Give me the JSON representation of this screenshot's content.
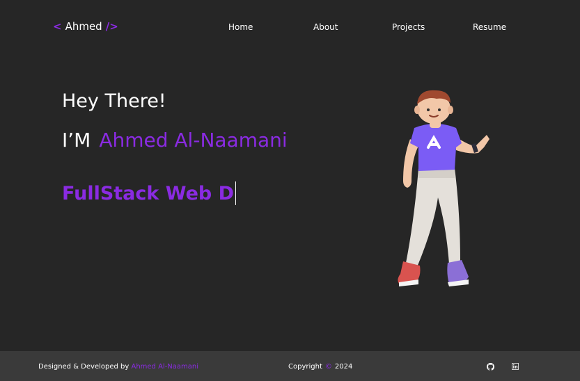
{
  "header": {
    "logo_open": "<",
    "logo_name": "Ahmed",
    "logo_close": "/>",
    "nav": [
      {
        "label": "Home"
      },
      {
        "label": "About"
      },
      {
        "label": "Projects"
      },
      {
        "label": "Resume"
      }
    ]
  },
  "hero": {
    "greeting": "Hey There!",
    "intro_prefix": "I’M",
    "intro_name": "Ahmed Al-Naamani",
    "typed_text": "FullStack Web D"
  },
  "footer": {
    "credit_prefix": "Designed & Developed by",
    "credit_author": "Ahmed Al-Naamani",
    "copyright_label": "Copyright",
    "copyright_symbol": "©",
    "copyright_year": "2024",
    "social": [
      {
        "icon": "github-icon"
      },
      {
        "icon": "linkedin-icon"
      }
    ]
  },
  "colors": {
    "background": "#262626",
    "accent": "#8a2be2",
    "footer_bg": "#3a3a3a"
  }
}
